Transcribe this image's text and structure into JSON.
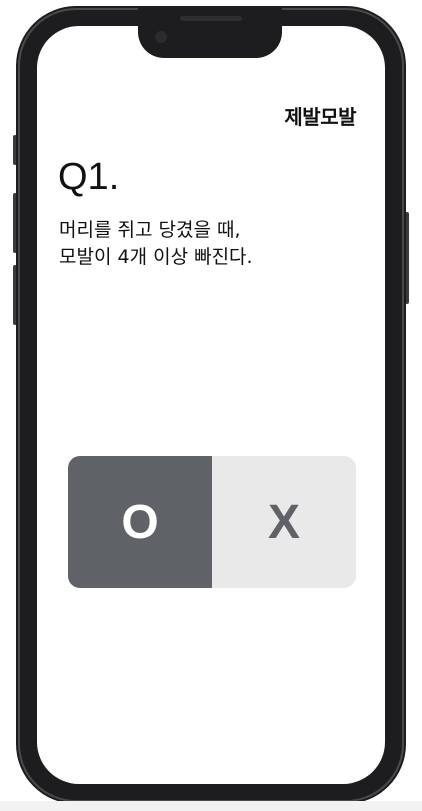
{
  "brand": {
    "name": "제발모발"
  },
  "question": {
    "number": "Q1.",
    "line1": "머리를 쥐고 당겼을 때,",
    "line2": "모발이 4개 이상 빠진다."
  },
  "answers": {
    "yes_label": "O",
    "no_label": "X",
    "selected": "O"
  },
  "colors": {
    "selected_bg": "#5f6368",
    "unselected_bg": "#e9e9ea",
    "frame": "#1d1d1f"
  }
}
